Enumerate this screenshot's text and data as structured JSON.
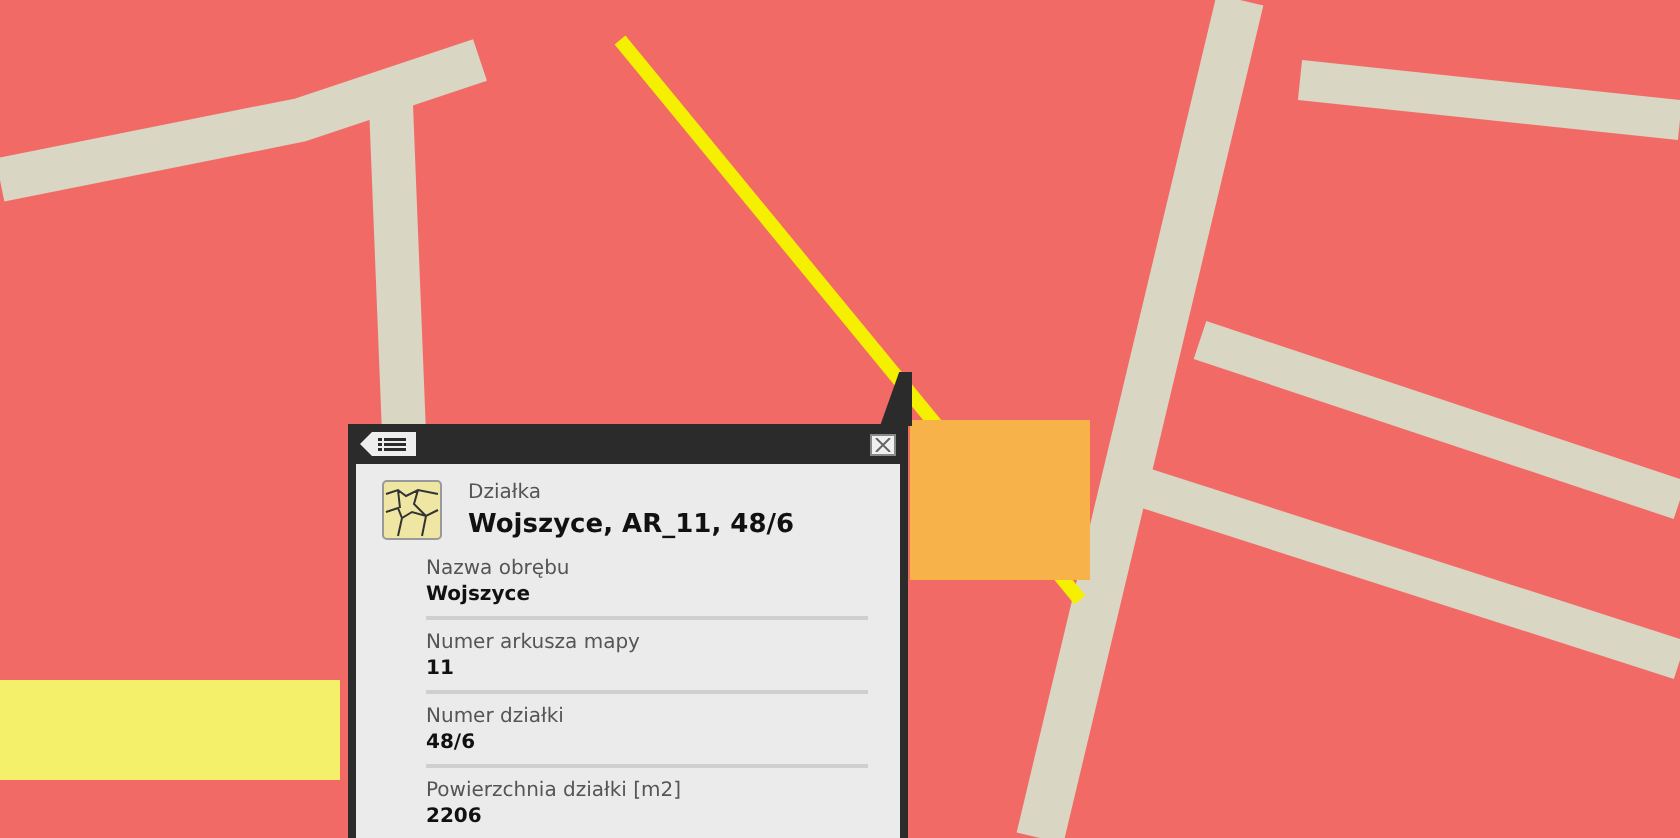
{
  "popup": {
    "category": "Działka",
    "title": "Wojszyce, AR_11, 48/6",
    "fields": [
      {
        "label": "Nazwa obrębu",
        "value": "Wojszyce"
      },
      {
        "label": "Numer arkusza mapy",
        "value": "11"
      },
      {
        "label": "Numer działki",
        "value": "48/6"
      },
      {
        "label": "Powierzchnia działki [m2]",
        "value": "2206"
      }
    ]
  }
}
